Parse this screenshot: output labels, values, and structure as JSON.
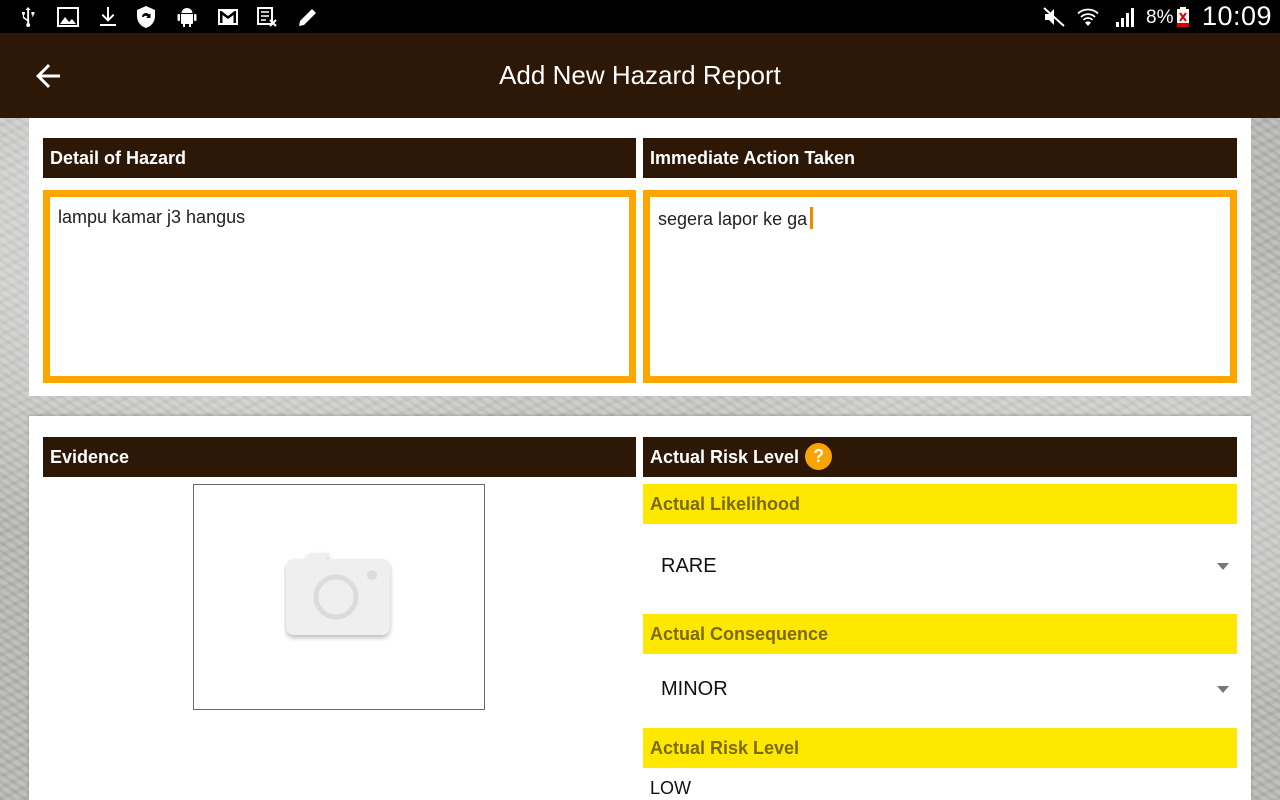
{
  "status_bar": {
    "left_icons": [
      "usb-icon",
      "image-icon",
      "download-icon",
      "shield-sync-icon",
      "android-icon",
      "gmail-icon",
      "task-icon",
      "edit-icon"
    ],
    "right_icons": [
      "mute-icon",
      "wifi-icon",
      "signal-icon",
      "battery-icon"
    ],
    "battery_percent": "8%",
    "time": "10:09"
  },
  "app_bar": {
    "title": "Add New Hazard Report",
    "back_icon": "arrow-back-icon"
  },
  "detail_section": {
    "header": "Detail of Hazard",
    "value": "lampu kamar j3 hangus"
  },
  "action_section": {
    "header": "Immediate Action Taken",
    "value": "segera lapor ke ga"
  },
  "evidence_section": {
    "header": "Evidence",
    "icon": "camera-icon"
  },
  "risk_section": {
    "header": "Actual Risk Level",
    "help_symbol": "?",
    "likelihood_label": "Actual Likelihood",
    "likelihood_value": "RARE",
    "consequence_label": "Actual Consequence",
    "consequence_value": "MINOR",
    "risk_level_label": "Actual Risk Level",
    "risk_level_value": "LOW"
  },
  "colors": {
    "header_brown": "#2d1707",
    "input_border": "#ffa500",
    "label_yellow": "#ffe800",
    "label_text": "#7a6a00",
    "help_orange": "#f7a400"
  }
}
